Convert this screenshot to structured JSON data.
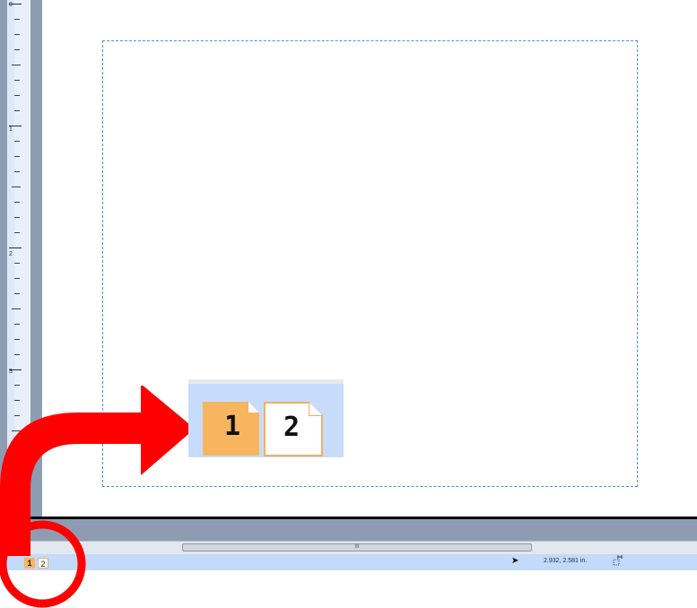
{
  "ruler": {
    "labels": [
      "0",
      "1",
      "2",
      "3"
    ]
  },
  "scrollbar": {
    "left_arrow": "◂",
    "grip": "III"
  },
  "statusbar": {
    "page_tabs": [
      "1",
      "2"
    ],
    "active_page": "1",
    "coordinates": "2.932, 2.581 in."
  },
  "zoom_inset": {
    "page_tabs": [
      "1",
      "2"
    ]
  },
  "colors": {
    "workspace": "#8d9cb1",
    "statusbar": "#c3dafa",
    "active_page": "#f7b55f",
    "page_border": "#f0b060",
    "guide": "#4a90e2",
    "annotation": "#ff0000"
  }
}
